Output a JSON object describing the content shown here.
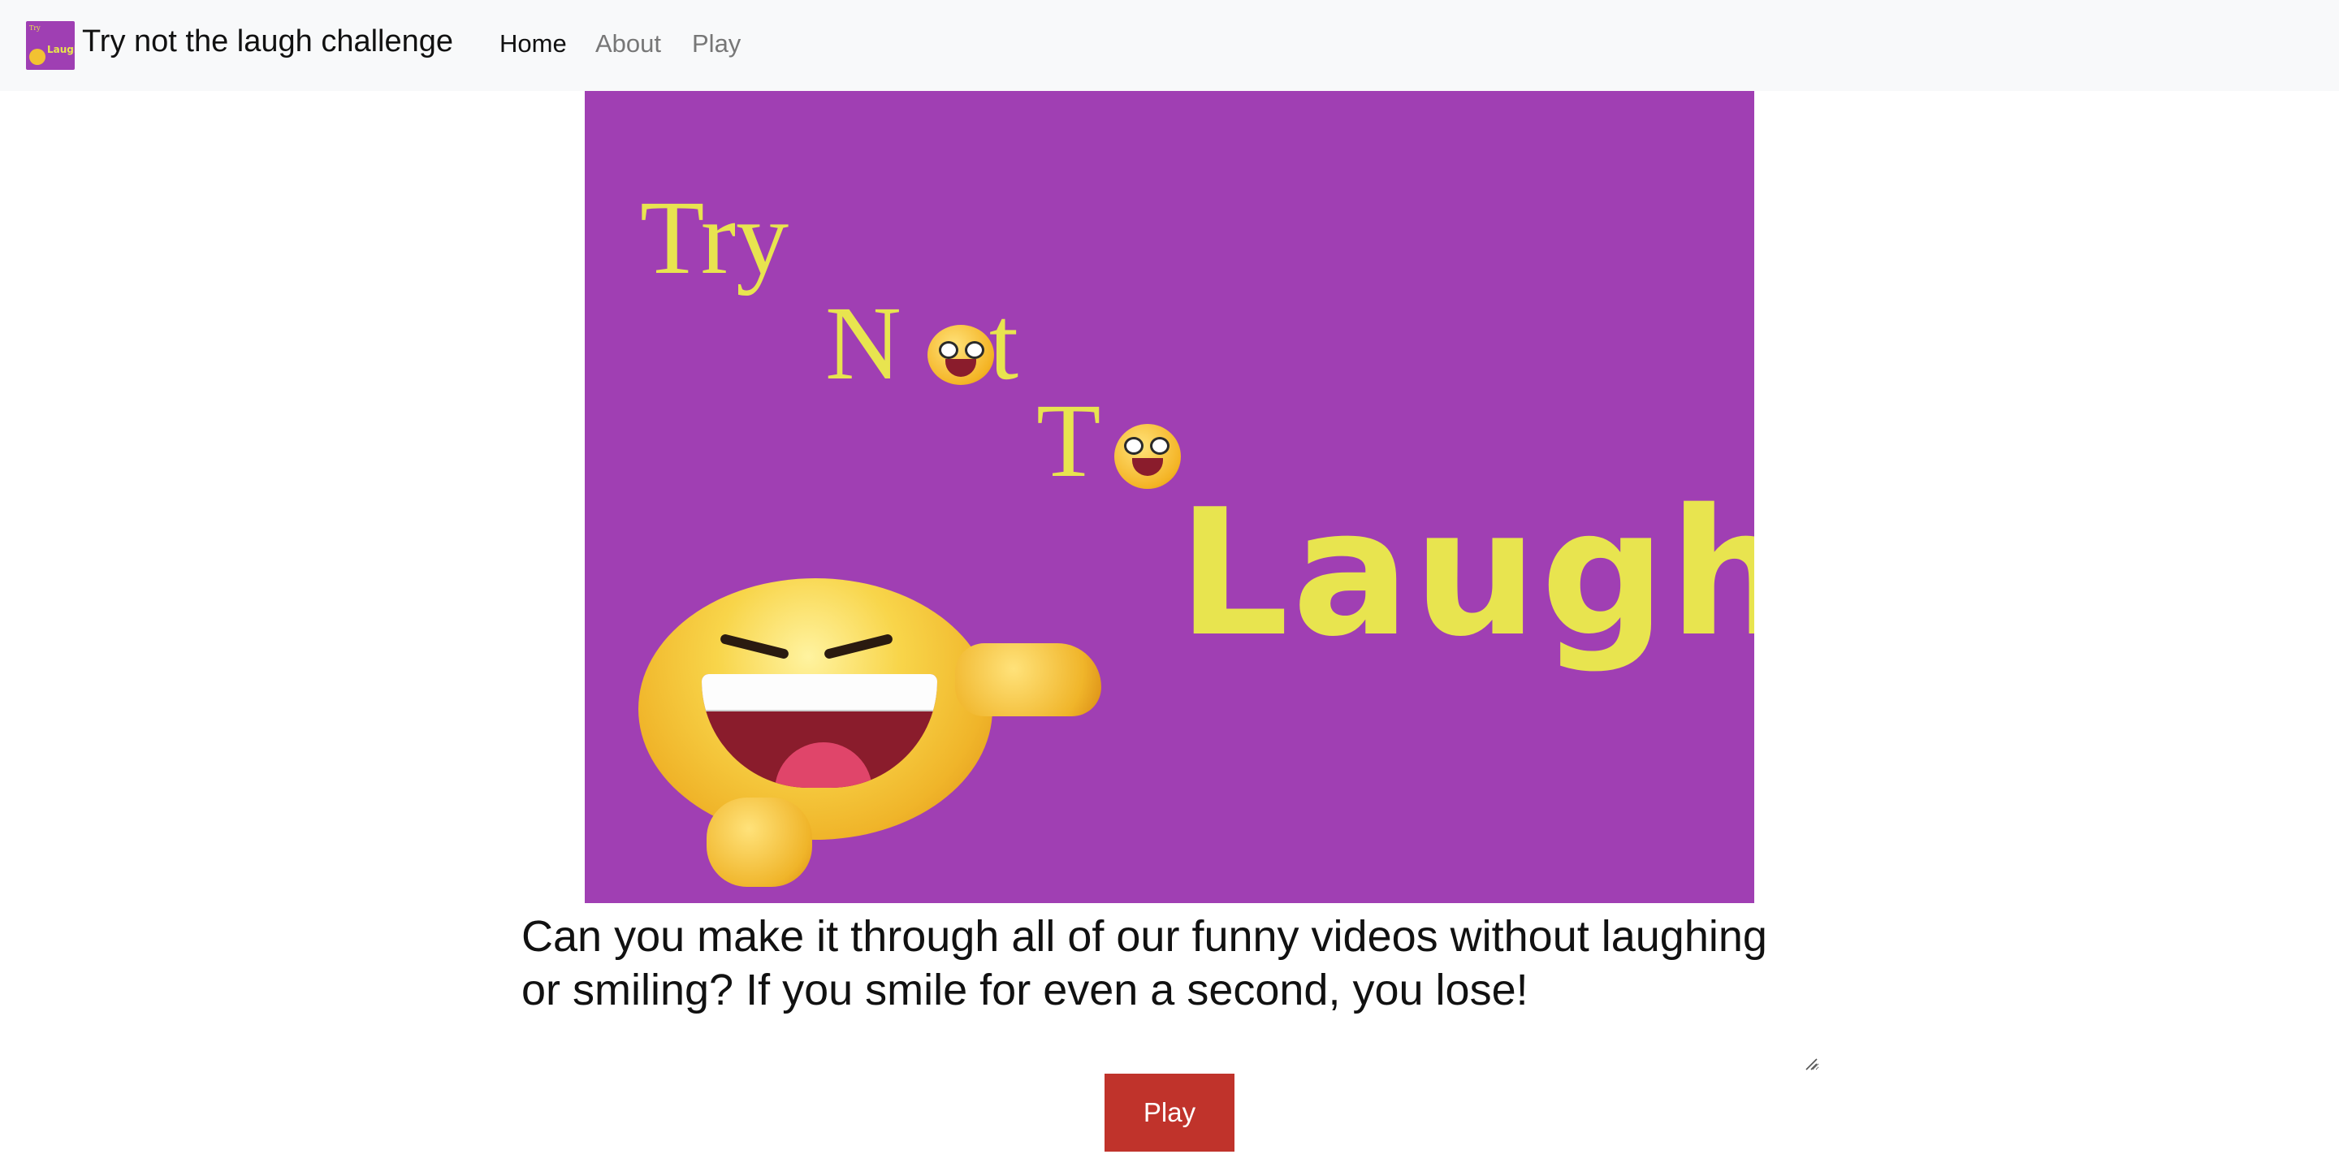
{
  "navbar": {
    "brand_title": "Try not the laugh challenge",
    "links": [
      {
        "label": "Home",
        "active": true
      },
      {
        "label": "About",
        "active": false
      },
      {
        "label": "Play",
        "active": false
      }
    ],
    "logo_text": "Laugh",
    "logo_text_small": "Try"
  },
  "hero": {
    "line1": "Try",
    "line2": "N",
    "line2_tail": "t",
    "line3": "T",
    "line4": "Laugh",
    "background_color": "#a03fb3",
    "text_color": "#e8e44f",
    "icons": [
      "laughing-with-tears-emoji-icon",
      "grinning-emoji-icon",
      "laughing-pointing-emoji-icon"
    ]
  },
  "description": {
    "text": "Can you make it through all of our funny videos without laughing or smiling? If you smile for even a second, you lose!"
  },
  "play_button": {
    "label": "Play",
    "color": "#c0332b"
  }
}
